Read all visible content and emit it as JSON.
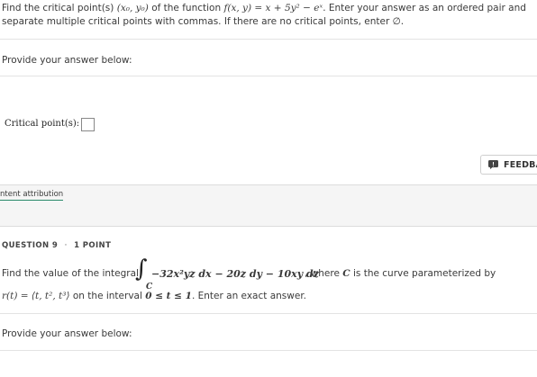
{
  "question8": {
    "prompt_prefix": "Find the critical point(s)",
    "point_notation": "(x₀, y₀)",
    "prompt_mid": "of the function",
    "function_expr": "f(x, y) = x + 5y² − eˣ",
    "prompt_suffix": ". Enter your answer as an ordered pair and",
    "prompt_line2": "separate multiple critical points with commas. If there are no critical points, enter ∅.",
    "provide_answer": "Provide your answer below:",
    "critical_label": "Critical point(s):",
    "answer_value": ""
  },
  "feedback_button": "FEEDBACK",
  "content_attribution": "ntent attribution",
  "question9": {
    "header_number": "QUESTION 9",
    "header_sep": "·",
    "header_points": "1 POINT",
    "prompt_prefix": "Find the value of the integral",
    "integral_symbol": "∫",
    "integral_sub": "C",
    "integrand": "−32x²yz dx − 20z dy − 10xy dz",
    "prompt_suffix": ", where",
    "curve_var": "C",
    "prompt_suffix2": "is the curve parameterized by",
    "param_expr": "r(t) = ⟨t, t², t³⟩",
    "interval_prefix": "on the interval",
    "interval_expr": "0 ≤ t ≤ 1",
    "interval_suffix": ". Enter an exact answer.",
    "provide_answer": "Provide your answer below:"
  },
  "colors": {
    "attribution_underline": "#2a8a6a",
    "divider": "#e3e3e3",
    "band": "#f5f5f5"
  }
}
